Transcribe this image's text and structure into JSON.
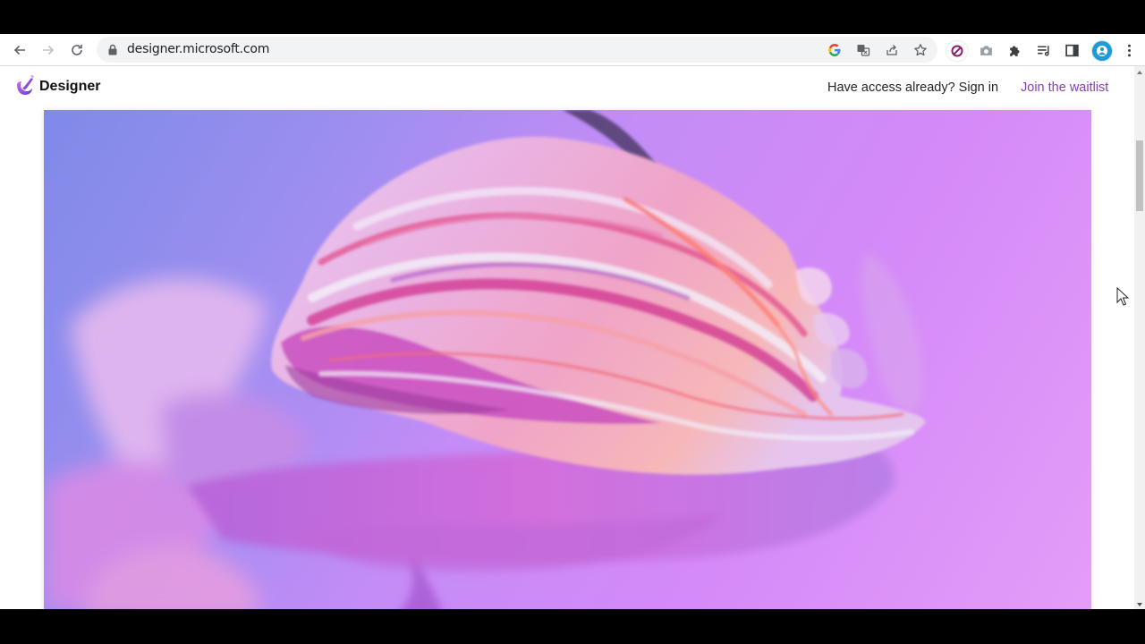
{
  "browser": {
    "url": "designer.microsoft.com",
    "nav": {
      "back_icon": "arrow-left-icon",
      "forward_icon": "arrow-right-icon",
      "reload_icon": "reload-icon"
    },
    "omnibox_icons": [
      "google-icon",
      "translate-icon",
      "share-icon",
      "bookmark-star-icon"
    ],
    "toolbar_icons": [
      "block-extension-icon",
      "camera-icon",
      "extensions-puzzle-icon",
      "reading-list-icon",
      "side-panel-icon",
      "profile-avatar",
      "kebab-menu-icon"
    ]
  },
  "site": {
    "brand": "Designer",
    "signin_label": "Have access already? Sign in",
    "waitlist_label": "Join the waitlist",
    "accent_color": "#8a3eb5"
  },
  "hero": {
    "description": "Abstract pink and purple paint brush stroke",
    "colors": [
      "#7f8ae8",
      "#c48cf6",
      "#e49df8",
      "#e0458f",
      "#f07a7a"
    ]
  }
}
